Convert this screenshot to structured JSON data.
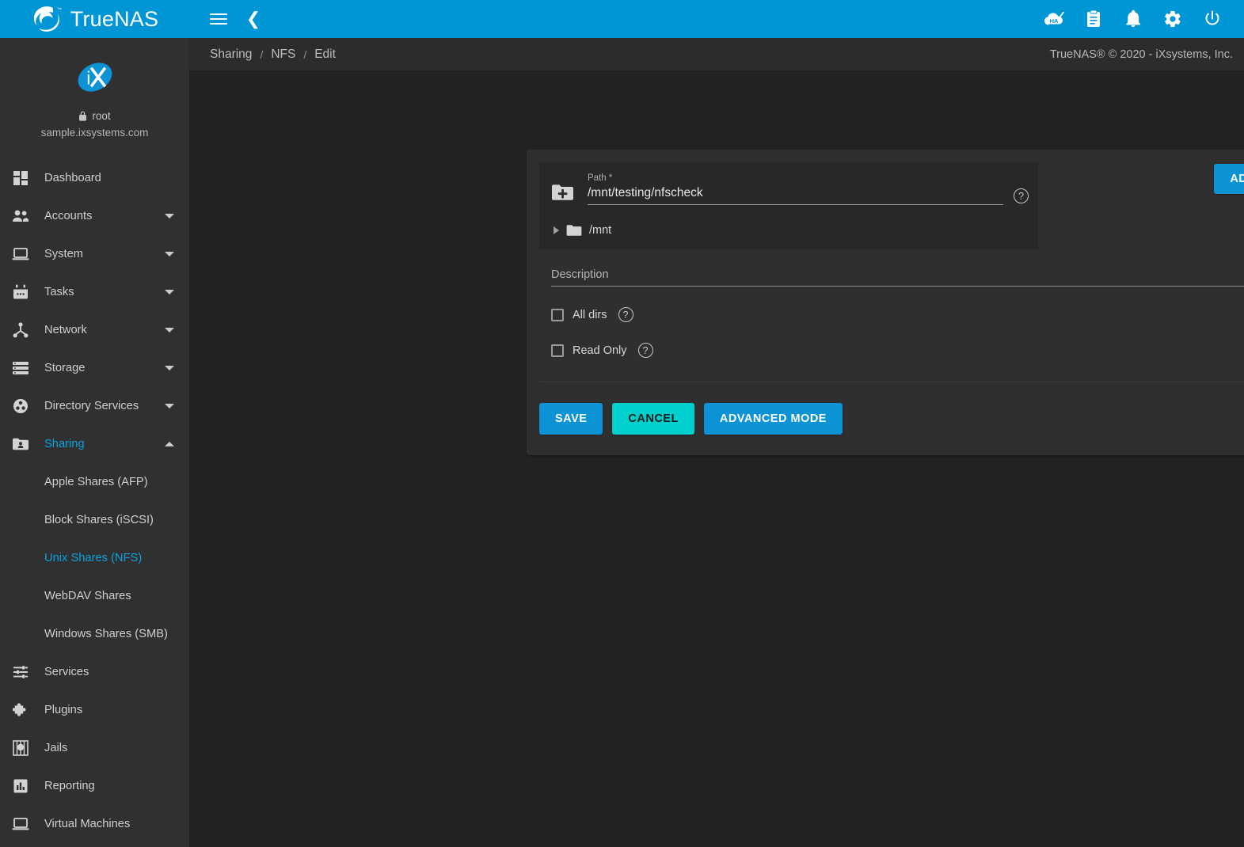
{
  "topbar": {
    "brand": "TrueNAS",
    "brand_tm": "™",
    "menu_icon": "hamburger-icon",
    "back_icon": "chevron-left-icon",
    "accent_color": "#0095d5",
    "actions": [
      {
        "name": "ha-status-icon",
        "label": "HA"
      },
      {
        "name": "task-manager-icon",
        "label": ""
      },
      {
        "name": "alerts-bell-icon",
        "label": ""
      },
      {
        "name": "settings-gear-icon",
        "label": ""
      },
      {
        "name": "power-icon",
        "label": ""
      }
    ]
  },
  "sidebar": {
    "user": "root",
    "hostname": "sample.ixsystems.com",
    "logo_text": "iX",
    "items": [
      {
        "label": "Dashboard",
        "icon": "dashboard-icon",
        "expandable": false,
        "active": false
      },
      {
        "label": "Accounts",
        "icon": "accounts-icon",
        "expandable": true,
        "active": false
      },
      {
        "label": "System",
        "icon": "system-icon",
        "expandable": true,
        "active": false
      },
      {
        "label": "Tasks",
        "icon": "tasks-calendar-icon",
        "expandable": true,
        "active": false
      },
      {
        "label": "Network",
        "icon": "network-icon",
        "expandable": true,
        "active": false
      },
      {
        "label": "Storage",
        "icon": "storage-icon",
        "expandable": true,
        "active": false
      },
      {
        "label": "Directory Services",
        "icon": "directory-services-icon",
        "expandable": true,
        "active": false
      },
      {
        "label": "Sharing",
        "icon": "sharing-folder-icon",
        "expandable": true,
        "active": true,
        "expanded": true
      }
    ],
    "sharing_children": [
      {
        "label": "Apple Shares (AFP)",
        "active": false
      },
      {
        "label": "Block Shares (iSCSI)",
        "active": false
      },
      {
        "label": "Unix Shares (NFS)",
        "active": true
      },
      {
        "label": "WebDAV Shares",
        "active": false
      },
      {
        "label": "Windows Shares (SMB)",
        "active": false
      }
    ],
    "items_after": [
      {
        "label": "Services",
        "icon": "services-sliders-icon",
        "expandable": false,
        "active": false
      },
      {
        "label": "Plugins",
        "icon": "plugins-puzzle-icon",
        "expandable": false,
        "active": false
      },
      {
        "label": "Jails",
        "icon": "jails-icon",
        "expandable": false,
        "active": false
      },
      {
        "label": "Reporting",
        "icon": "reporting-chart-icon",
        "expandable": false,
        "active": false
      },
      {
        "label": "Virtual Machines",
        "icon": "virtual-machines-icon",
        "expandable": false,
        "active": false
      }
    ],
    "active_color": "#0aa2e0"
  },
  "breadcrumb": {
    "items": [
      "Sharing",
      "NFS",
      "Edit"
    ],
    "separator": "/",
    "copyright": "TrueNAS® © 2020 - iXsystems, Inc."
  },
  "form": {
    "path": {
      "label": "Path *",
      "value": "/mnt/testing/nfscheck",
      "placeholder": "",
      "help_glyph": "?"
    },
    "add_button": "ADD",
    "new_folder_icon": "folder-plus-icon",
    "tree": [
      {
        "label": "/mnt",
        "expanded": false
      }
    ],
    "description": {
      "label": "Description",
      "value": "",
      "placeholder": "Description",
      "help_glyph": "?"
    },
    "checkboxes": [
      {
        "label": "All dirs",
        "checked": false,
        "help_glyph": "?"
      },
      {
        "label": "Read Only",
        "checked": false,
        "help_glyph": "?"
      }
    ],
    "buttons": {
      "save": "SAVE",
      "cancel": "CANCEL",
      "advanced": "ADVANCED MODE"
    },
    "colors": {
      "primary": "#0b93d5",
      "cancel": "#00d0cd",
      "card_bg": "#2f2f2f",
      "explorer_bg": "#282828"
    }
  }
}
